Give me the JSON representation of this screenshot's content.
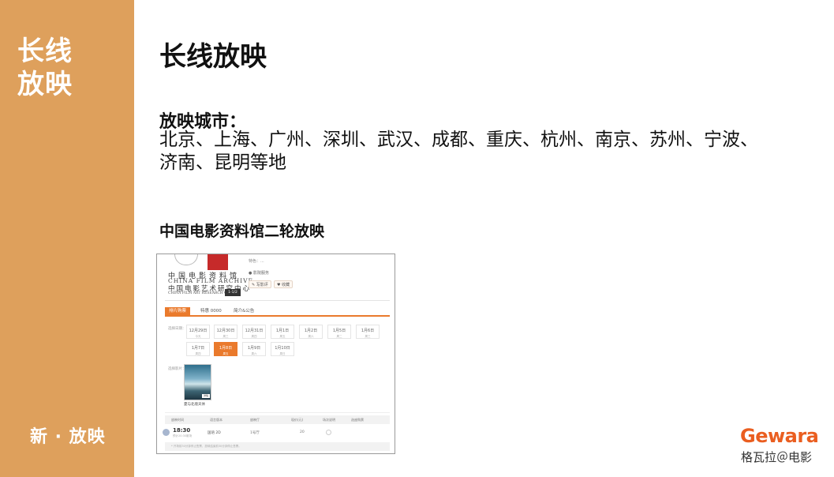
{
  "sidebar": {
    "title_line1": "长线",
    "title_line2": "放映",
    "brand": "新 · 放映",
    "background_color": "#dea05c"
  },
  "main": {
    "title": "长线放映",
    "cities_label": "放映城市：",
    "cities_text": "北京、上海、广州、深圳、武汉、成都、重庆、杭州、南京、苏州、宁波、济南、昆明等地",
    "sub_title": "中国电影资料馆二轮放映"
  },
  "screenshot": {
    "archive_name_cn": "中国电影资料馆",
    "archive_name_en": "CHINA FILM ARCHIVE",
    "archive_name_cn2": "中国电影艺术研究中心",
    "archive_name_en2": "CHINA FILM ART RESEARCH CENTER",
    "badge": "1-1/2",
    "meta_line": "特色：...",
    "meta_features": "● 影院服务",
    "write_review_label": "✎ 写影评",
    "favorite_label": "♥ 收藏",
    "tabs": [
      {
        "label": "排片购票"
      },
      {
        "label": "特惠 0000"
      },
      {
        "label": "简介&公告"
      }
    ],
    "date_label": "选择日期：",
    "dates": [
      {
        "date": "12月29日",
        "week": "今天"
      },
      {
        "date": "12月30日",
        "week": "周三"
      },
      {
        "date": "12月31日",
        "week": "周四"
      },
      {
        "date": "1月1日",
        "week": "周五"
      },
      {
        "date": "1月2日",
        "week": "周六"
      },
      {
        "date": "1月5日",
        "week": "周二"
      },
      {
        "date": "1月6日",
        "week": "周三"
      },
      {
        "date": "1月7日",
        "week": "周四"
      },
      {
        "date": "1月8日",
        "week": "周五"
      },
      {
        "date": "1月9日",
        "week": "周六"
      },
      {
        "date": "1月10日",
        "week": "周日"
      }
    ],
    "selected_date_index": 8,
    "film_label": "选择影片：",
    "film_title": "夏与北境天体",
    "poster_tag": "详情",
    "table_headers": [
      "放映时间",
      "语言版本",
      "放映厅",
      "现价(元)",
      "场次说明",
      "选座购票"
    ],
    "row": {
      "time": "18:30",
      "sub": "预计20:30散场",
      "lang": "国语 2D",
      "hall": "1号厅",
      "price": "20"
    },
    "footnote": "* 开场前30分钟停止售票，放映结束前30分钟停止售票。",
    "accent_color": "#ea7a2c"
  },
  "logo": {
    "word": "Gewara",
    "cn": "格瓦拉＠电影",
    "color": "#ea5e20"
  }
}
